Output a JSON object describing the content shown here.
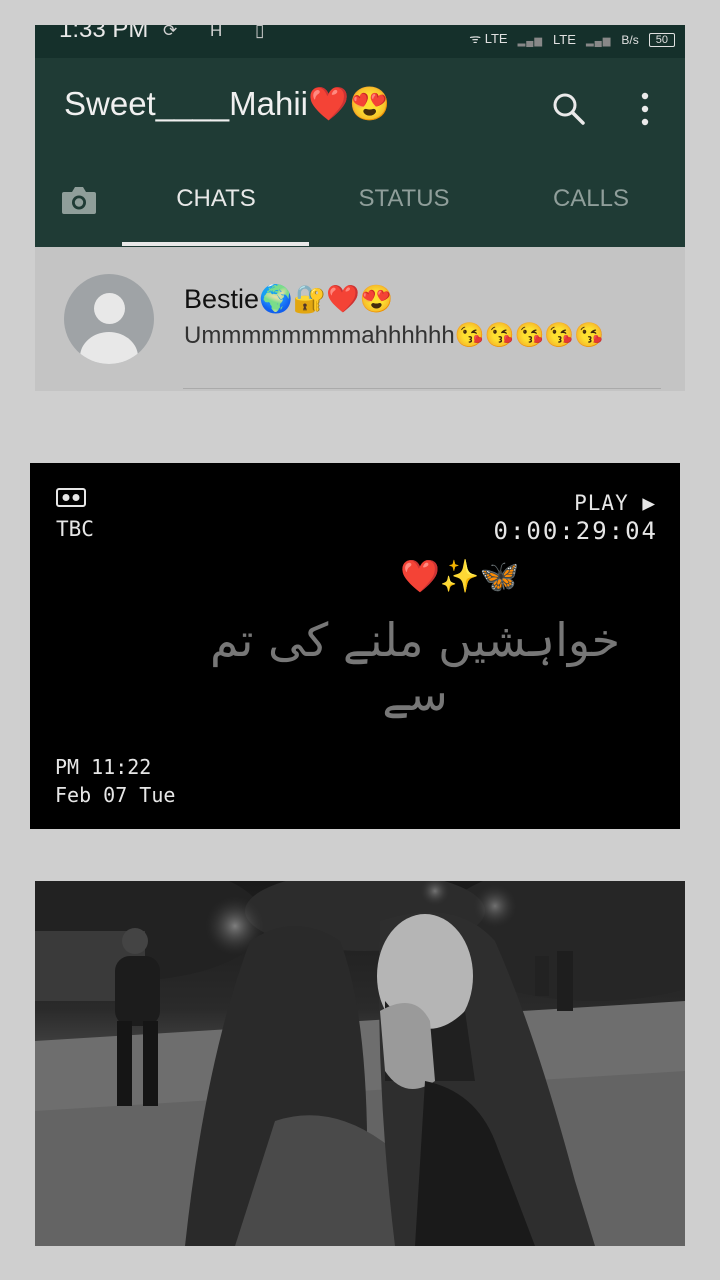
{
  "status_bar": {
    "time": "1:33 PM",
    "left_icons": "⟳ H ▯",
    "lte1": "ᯤ LTE",
    "lte2": "LTE",
    "bars": "▂▄▆",
    "speed": "B/s",
    "battery": "50"
  },
  "header": {
    "title": "Sweet____Mahii❤️😍"
  },
  "tabs": [
    {
      "label": "CHATS",
      "active": true
    },
    {
      "label": "STATUS",
      "active": false
    },
    {
      "label": "CALLS",
      "active": false
    }
  ],
  "chat": {
    "name": "Bestie🌍🔐❤️😍",
    "preview": "Ummmmmmmmahhhhhh😘😘😘😘😘"
  },
  "vhs": {
    "tbc": "TBC",
    "play": "PLAY ▶",
    "counter": "0:00:29:04",
    "emojis": "❤️✨🦋",
    "urdu_text": "خواہشیں ملنے کی تم سے",
    "time": "PM 11:22",
    "date": "Feb 07 Tue"
  },
  "colors": {
    "header_bg": "#1f3b35",
    "status_bg": "#15302b",
    "page_bg": "#cfcfcf"
  }
}
